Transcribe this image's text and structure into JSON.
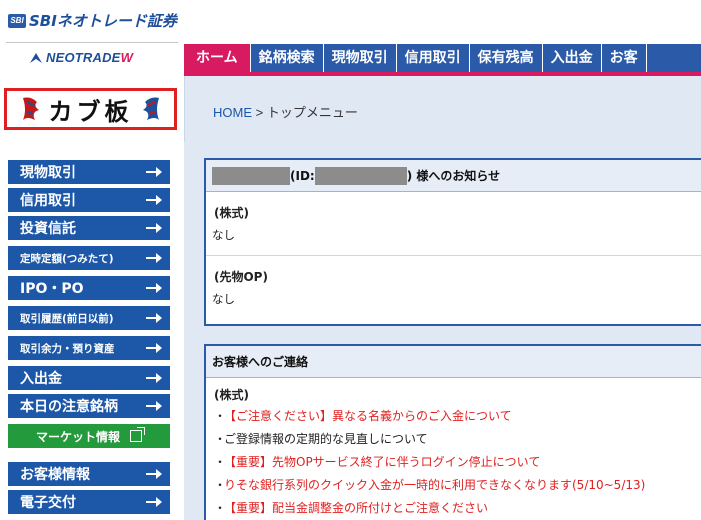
{
  "logo": {
    "sbi_badge": "SBI",
    "brand_name": "SBIネオトレード証券",
    "brand_short": "ネオトレード証券",
    "neotrade_main": "NEOTRADE",
    "neotrade_w": "W"
  },
  "global_nav": {
    "items": [
      {
        "label": "ホーム",
        "active": true
      },
      {
        "label": "銘柄検索",
        "active": false
      },
      {
        "label": "現物取引",
        "active": false
      },
      {
        "label": "信用取引",
        "active": false
      },
      {
        "label": "保有残高",
        "active": false
      },
      {
        "label": "入出金",
        "active": false
      },
      {
        "label": "お客",
        "active": false
      }
    ],
    "accent_color": "#d81b60",
    "base_color": "#2a5aa8"
  },
  "sidebar": {
    "kabuita_label": "カブ板",
    "items": [
      {
        "label": "現物取引",
        "size": "normal"
      },
      {
        "label": "信用取引",
        "size": "normal"
      },
      {
        "label": "投資信託",
        "size": "normal"
      },
      {
        "label": "定時定額(つみたて)",
        "size": "small"
      },
      {
        "label": "IPO・PO",
        "size": "normal"
      },
      {
        "label": "取引履歴(前日以前)",
        "size": "small"
      },
      {
        "label": "取引余力・預り資産",
        "size": "small"
      },
      {
        "label": "入出金",
        "size": "normal"
      },
      {
        "label": "本日の注意銘柄",
        "size": "normal"
      },
      {
        "label": "マーケット情報",
        "size": "green"
      },
      {
        "label": "お客様情報",
        "size": "normal"
      },
      {
        "label": "電子交付",
        "size": "normal"
      }
    ],
    "button_color": "#1d57a8",
    "green_color": "#239a3b",
    "highlight_border": "#e02020"
  },
  "breadcrumb": {
    "home": "HOME",
    "separator": " > ",
    "current": "トップメニュー"
  },
  "notice_panel": {
    "title_id_prefix": "(ID:",
    "title_suffix": ") 様へのお知らせ",
    "sections": [
      {
        "heading": "(株式)",
        "value": "なし"
      },
      {
        "heading": "(先物OP)",
        "value": "なし"
      }
    ]
  },
  "contact_panel": {
    "title": "お客様へのご連絡",
    "section_heading": "(株式)",
    "items": [
      {
        "text": "【ご注意ください】異なる名義からのご入金について",
        "color": "red"
      },
      {
        "text": "ご登録情報の定期的な見直しについて",
        "color": "black"
      },
      {
        "text": "【重要】先物OPサービス終了に伴うログイン停止について",
        "color": "red"
      },
      {
        "text": "りそな銀行系列のクイック入金が一時的に利用できなくなります(5/10~5/13)",
        "color": "red"
      },
      {
        "text": "【重要】配当金調整金の所付けとご注意ください",
        "color": "red"
      }
    ],
    "bullet": "・"
  }
}
